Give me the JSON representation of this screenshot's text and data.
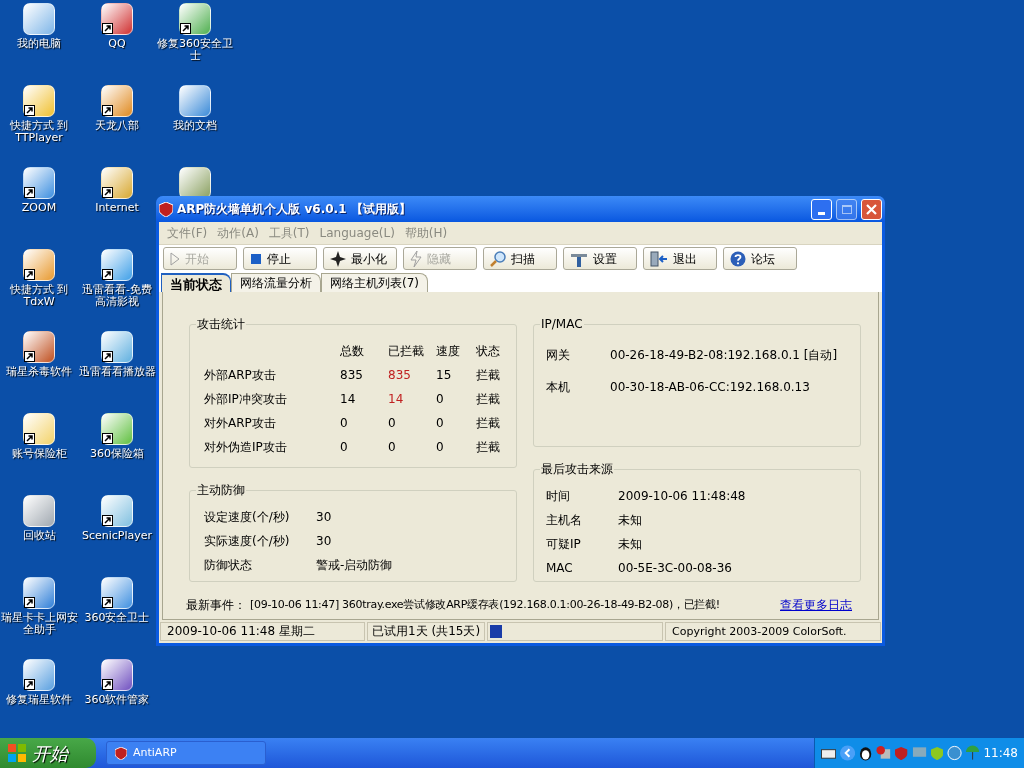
{
  "desktop_icons": [
    {
      "label": "我的电脑",
      "shortcut": false
    },
    {
      "label": "快捷方式 到 TTPlayer",
      "shortcut": true
    },
    {
      "label": "ZOOM",
      "shortcut": true
    },
    {
      "label": "快捷方式 到 TdxW",
      "shortcut": true
    },
    {
      "label": "瑞星杀毒软件",
      "shortcut": true
    },
    {
      "label": "账号保险柜",
      "shortcut": true
    },
    {
      "label": "回收站",
      "shortcut": false
    },
    {
      "label": "瑞星卡卡上网安全助手",
      "shortcut": true
    },
    {
      "label": "修复瑞星软件",
      "shortcut": true
    },
    {
      "label": "QQ",
      "shortcut": true
    },
    {
      "label": "天龙八部",
      "shortcut": true
    },
    {
      "label": "Internet",
      "shortcut": true
    },
    {
      "label": "迅雷看看-免费高清影视",
      "shortcut": true
    },
    {
      "label": "迅雷看看播放器",
      "shortcut": true
    },
    {
      "label": "360保险箱",
      "shortcut": true
    },
    {
      "label": "ScenicPlayer",
      "shortcut": true
    },
    {
      "label": "360安全卫士",
      "shortcut": true
    },
    {
      "label": "360软件管家",
      "shortcut": true
    },
    {
      "label": "修复360安全卫士",
      "shortcut": true
    },
    {
      "label": "我的文档",
      "shortcut": false
    },
    {
      "shortcut": false
    }
  ],
  "window": {
    "title": "ARP防火墙单机个人版 v6.0.1 【试用版】",
    "menu": [
      "文件(F)",
      "动作(A)",
      "工具(T)",
      "Language(L)",
      "帮助(H)"
    ],
    "toolbar": [
      {
        "label": "开始",
        "kind": "play",
        "disabled": true
      },
      {
        "label": "停止",
        "kind": "stop",
        "disabled": false
      },
      {
        "label": "最小化",
        "kind": "minimize",
        "disabled": false
      },
      {
        "label": "隐藏",
        "kind": "lightning",
        "disabled": true
      },
      {
        "label": "扫描",
        "kind": "search",
        "disabled": false
      },
      {
        "label": "设置",
        "kind": "tools",
        "disabled": false
      },
      {
        "label": "退出",
        "kind": "exit",
        "disabled": false
      },
      {
        "label": "论坛",
        "kind": "help",
        "disabled": false
      }
    ],
    "tabs": [
      {
        "label": "当前状态",
        "selected": true
      },
      {
        "label": "网络流量分析",
        "selected": false
      },
      {
        "label": "网络主机列表(7)",
        "selected": false
      }
    ],
    "attack_stats": {
      "title": "攻击统计",
      "columns": [
        "总数",
        "已拦截",
        "速度",
        "状态"
      ],
      "rows": [
        {
          "name": "外部ARP攻击",
          "total": "835",
          "blocked": "835",
          "alert": true,
          "speed": "15",
          "status": "拦截"
        },
        {
          "name": "外部IP冲突攻击",
          "total": "14",
          "blocked": "14",
          "alert": true,
          "speed": "0",
          "status": "拦截"
        },
        {
          "name": "对外ARP攻击",
          "total": "0",
          "blocked": "0",
          "alert": false,
          "speed": "0",
          "status": "拦截"
        },
        {
          "name": "对外伪造IP攻击",
          "total": "0",
          "blocked": "0",
          "alert": false,
          "speed": "0",
          "status": "拦截"
        }
      ]
    },
    "active_defense": {
      "title": "主动防御",
      "rows": [
        {
          "label": "设定速度(个/秒)",
          "value": "30"
        },
        {
          "label": "实际速度(个/秒)",
          "value": "30"
        },
        {
          "label": "防御状态",
          "value": "警戒-启动防御"
        }
      ]
    },
    "ip_mac": {
      "title": "IP/MAC",
      "rows": [
        {
          "label": "网关",
          "value": "00-26-18-49-B2-08:192.168.0.1 [自动]"
        },
        {
          "label": "本机",
          "value": "00-30-18-AB-06-CC:192.168.0.13"
        }
      ]
    },
    "last_attack": {
      "title": "最后攻击来源",
      "rows": [
        {
          "label": "时间",
          "value": "2009-10-06 11:48:48"
        },
        {
          "label": "主机名",
          "value": "未知"
        },
        {
          "label": "可疑IP",
          "value": "未知"
        },
        {
          "label": "MAC",
          "value": "00-5E-3C-00-08-36"
        }
      ]
    },
    "event": {
      "label": "最新事件：",
      "text": "[09-10-06 11:47] 360tray.exe尝试修改ARP缓存表(192.168.0.1:00-26-18-49-B2-08)，已拦截!",
      "link": "查看更多日志"
    },
    "status_bar": {
      "datetime": "2009-10-06 11:48 星期二",
      "trial": "已试用1天 (共15天)",
      "level": 0.07,
      "copyright": "Copyright 2003-2009 ColorSoft."
    }
  },
  "taskbar": {
    "start": "开始",
    "tasks": [
      {
        "label": "AntiARP",
        "selected": false
      }
    ],
    "clock": "11:48"
  }
}
